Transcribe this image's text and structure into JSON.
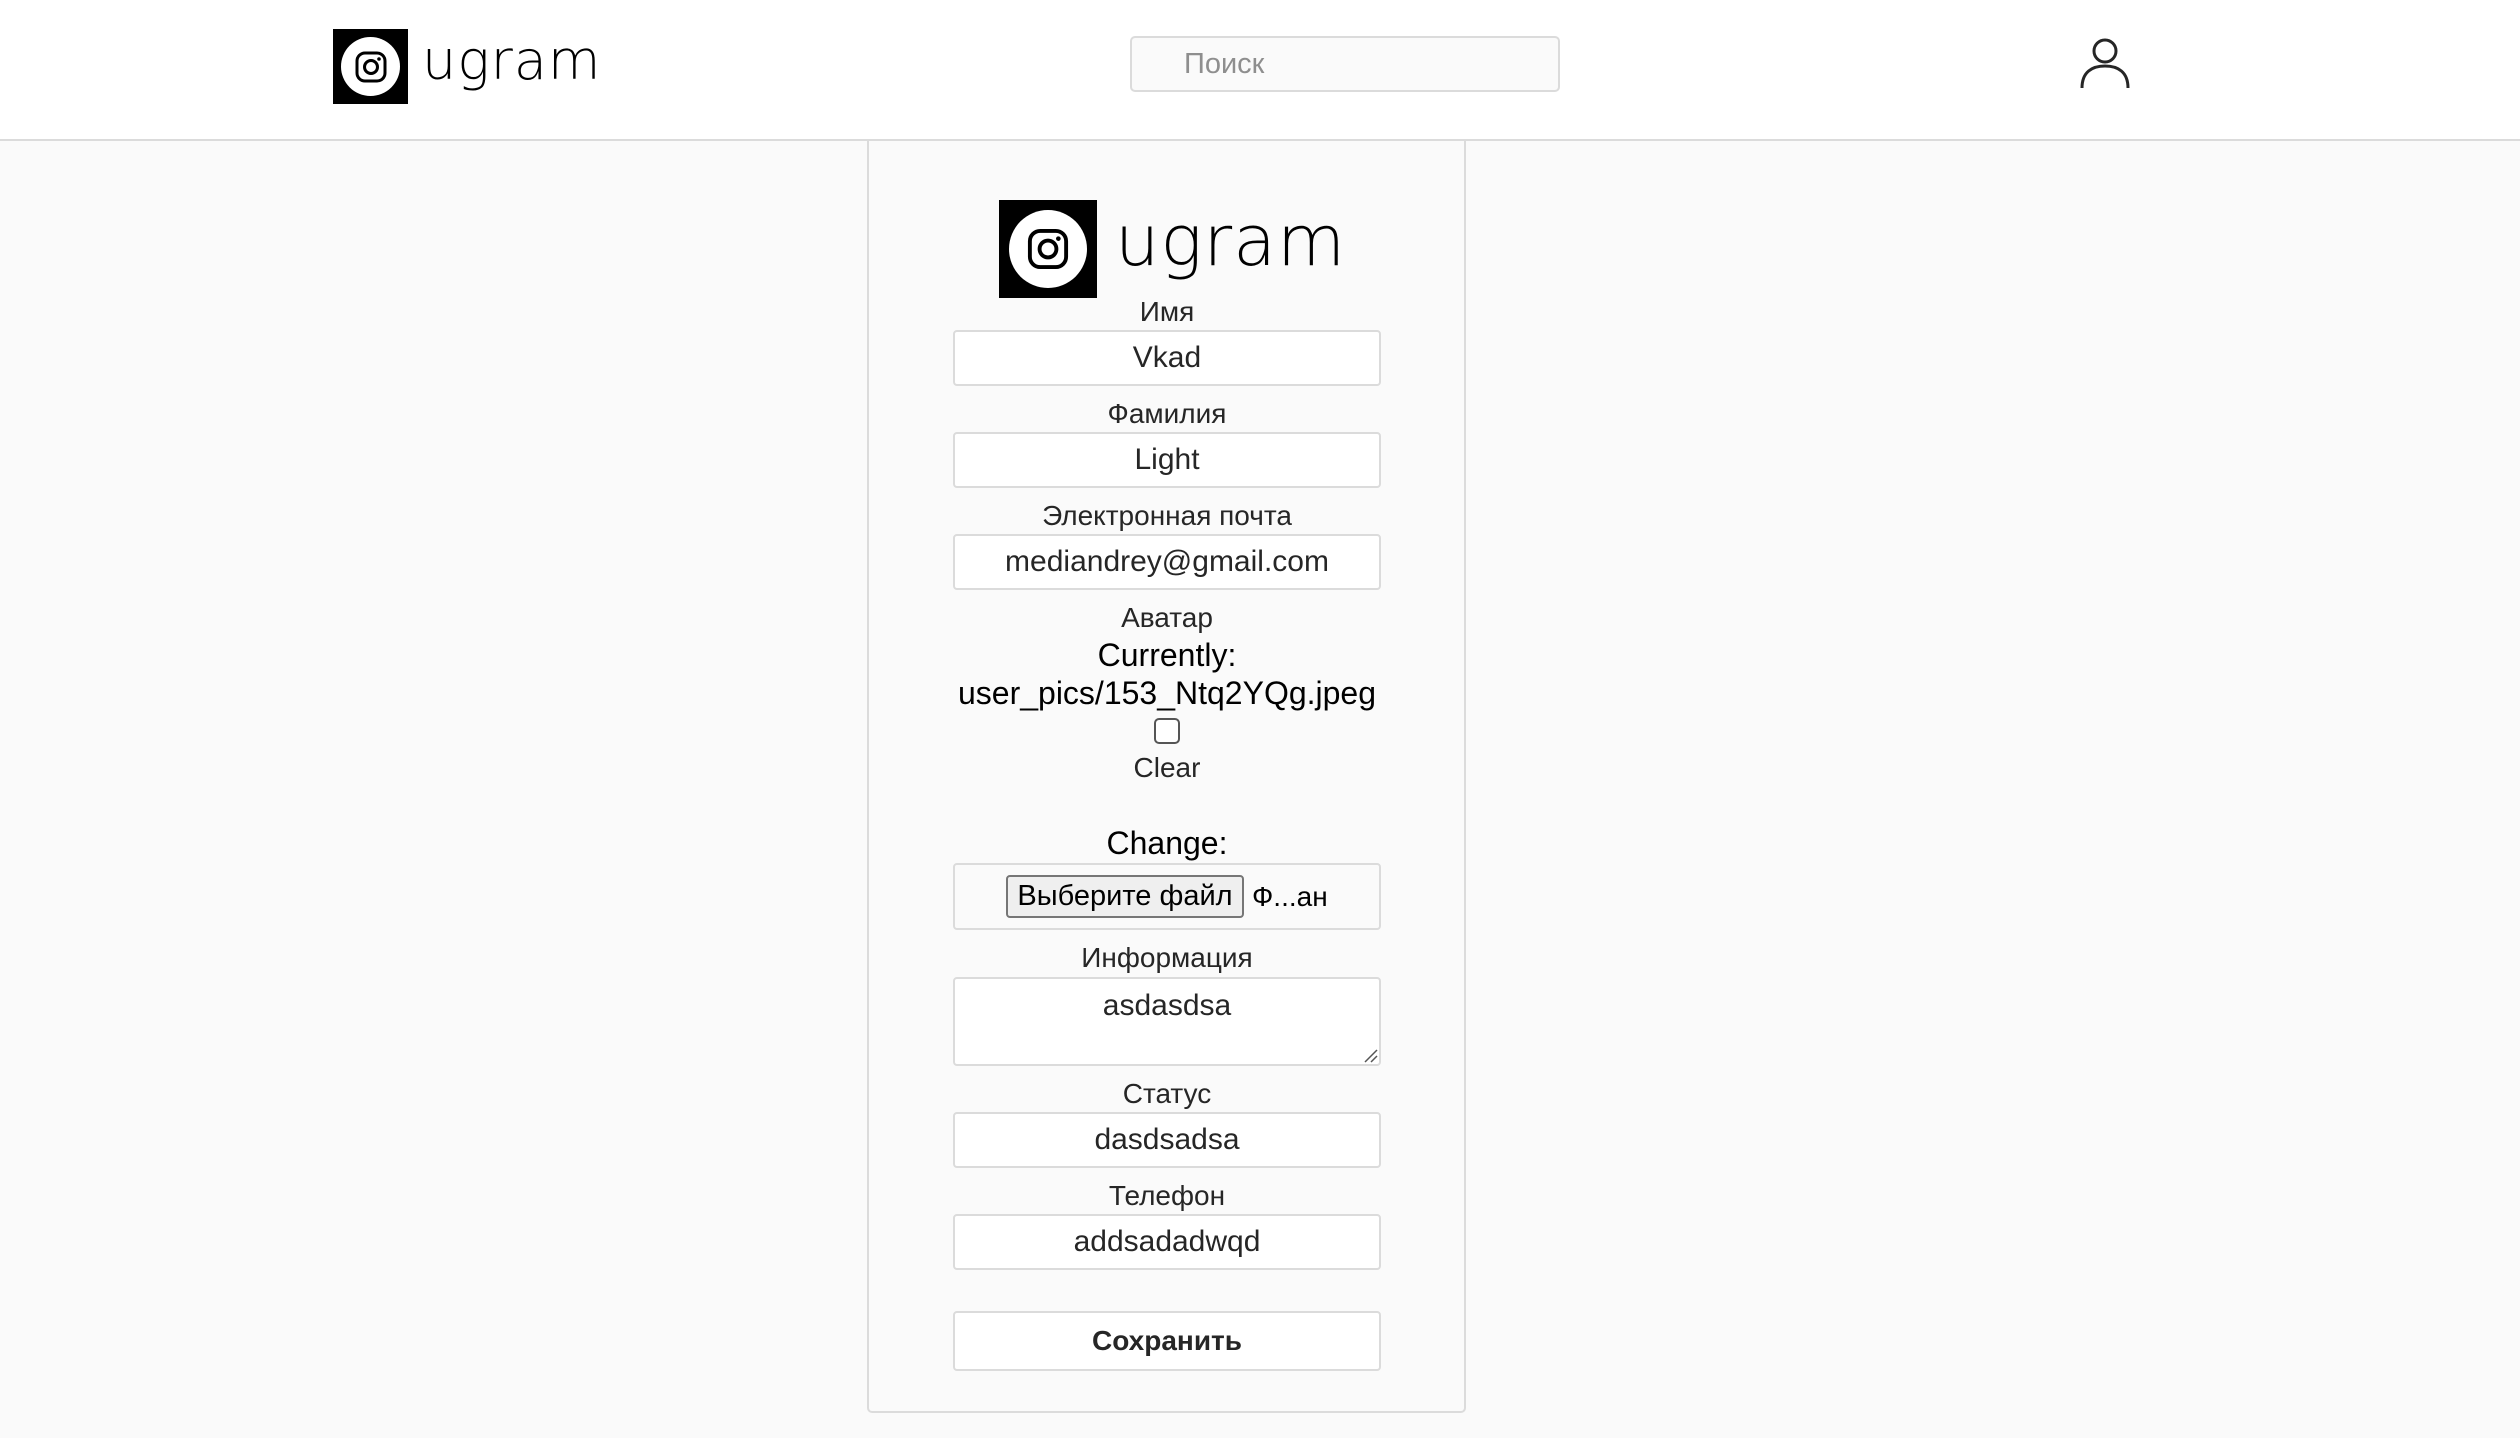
{
  "header": {
    "logo_text": "ugram",
    "search_placeholder": "Поиск",
    "profile_icon": "user-icon"
  },
  "form": {
    "logo_text": "ugram",
    "first_name": {
      "label": "Имя",
      "value": "Vkad"
    },
    "last_name": {
      "label": "Фамилия",
      "value": "Light"
    },
    "email": {
      "label": "Электронная почта",
      "value": "mediandrey@gmail.com"
    },
    "avatar": {
      "label": "Аватар",
      "currently_label": "Currently:",
      "current_file": "user_pics/153_Ntq2YQg.jpeg",
      "clear_label": "Clear",
      "change_label": "Change:",
      "choose_button": "Выберите файл",
      "file_status": "Ф...ан"
    },
    "info": {
      "label": "Информация",
      "value": "asdasdsa"
    },
    "status": {
      "label": "Статус",
      "value": "dasdsadsa"
    },
    "phone": {
      "label": "Телефон",
      "value": "addsadadwqd"
    },
    "save_button": "Сохранить"
  },
  "colors": {
    "background": "#fafafa",
    "border": "#dbdbdb",
    "logo": "#000000"
  }
}
